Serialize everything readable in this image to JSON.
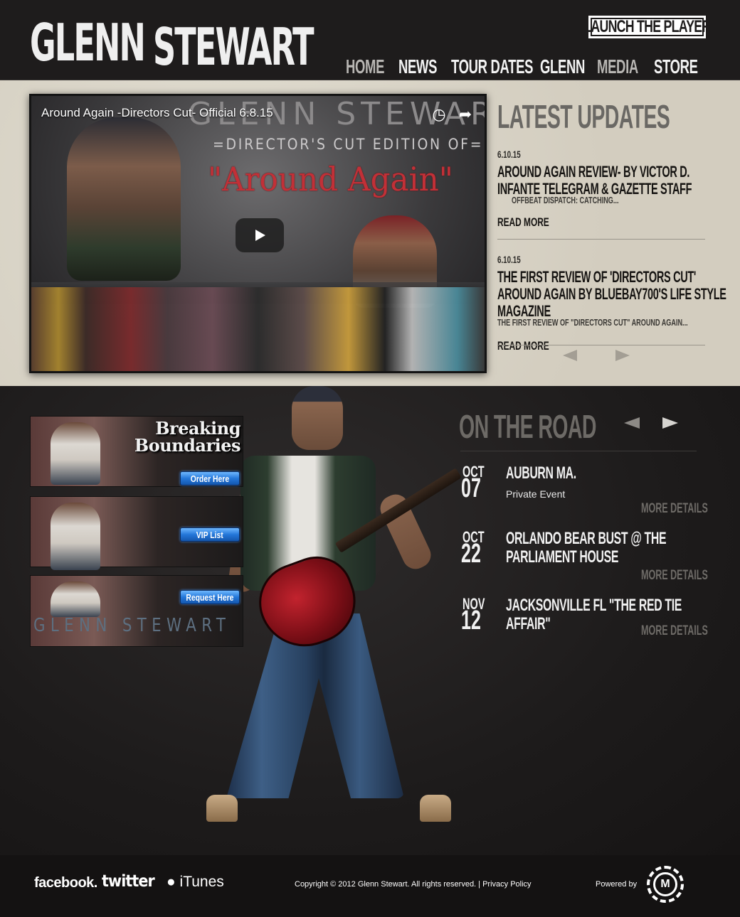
{
  "header": {
    "logo_first": "GLENN",
    "logo_last": "STEWART",
    "launch_label": "LAUNCH THE PLAYER",
    "nav": [
      "HOME",
      "NEWS",
      "TOUR DATES",
      "GLENN",
      "MEDIA",
      "STORE"
    ]
  },
  "video": {
    "title": "Around Again -Directors Cut- Official 6.8.15",
    "brand": "GLENN STEWART",
    "edition": "=DIRECTOR'S CUT EDITION OF=",
    "album": "\"Around Again\""
  },
  "updates": {
    "heading": "LATEST UPDATES",
    "items": [
      {
        "date": "6.10.15",
        "headline": "AROUND AGAIN REVIEW- BY VICTOR D.\nINFANTE TELEGRAM & GAZETTE STAFF",
        "teaser": "OFFBEAT DISPATCH: CATCHING...",
        "more": "READ MORE"
      },
      {
        "date": "6.10.15",
        "headline": "THE FIRST REVIEW OF 'DIRECTORS CUT'\nAROUND AGAIN BY BLUEBAY700'S LIFE STYLE\nMAGAZINE",
        "teaser": "THE FIRST REVIEW OF \"DIRECTORS CUT\" AROUND AGAIN...",
        "more": "READ MORE"
      }
    ]
  },
  "promo": {
    "title": "Breaking\nBoundaries",
    "order_label": "Order Here",
    "vip_label": "VIP List",
    "request_label": "Request Here",
    "wordmark": "GLENN STEWART"
  },
  "road": {
    "heading": "ON THE ROAD",
    "gigs": [
      {
        "month": "OCT",
        "day": "07",
        "venue": "AUBURN MA.",
        "sub": "Private Event",
        "details": "MORE DETAILS"
      },
      {
        "month": "OCT",
        "day": "22",
        "venue": "ORLANDO BEAR BUST @ THE\nPARLIAMENT HOUSE",
        "sub": "",
        "details": "MORE DETAILS"
      },
      {
        "month": "NOV",
        "day": "12",
        "venue": "JACKSONVILLE FL \"THE RED TIE\nAFFAIR\"",
        "sub": "",
        "details": "MORE DETAILS"
      }
    ]
  },
  "footer": {
    "facebook": "facebook.",
    "twitter": "twitter",
    "itunes": "iTunes",
    "copyright": "Copyright © 2012 Glenn Stewart. All rights reserved. | Privacy Policy",
    "powered": "Powered by",
    "badge_letter": "M"
  }
}
